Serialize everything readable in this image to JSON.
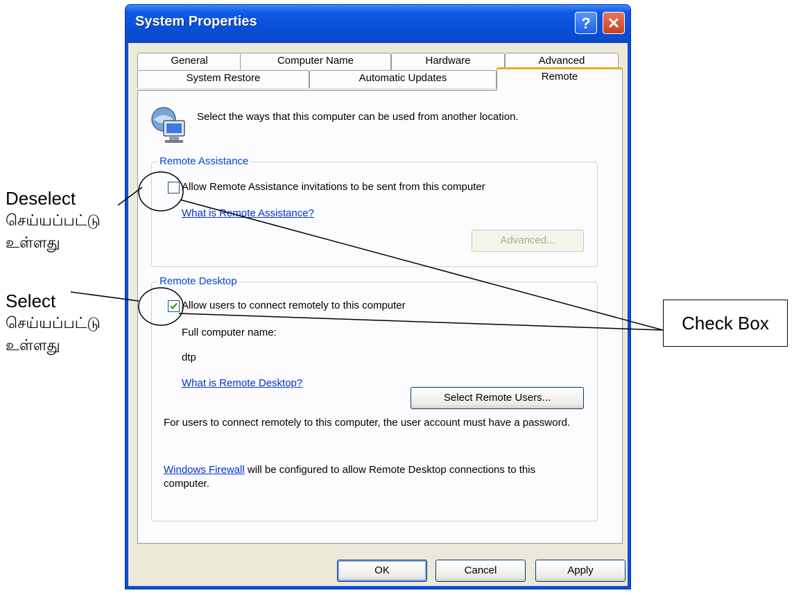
{
  "window": {
    "title": "System Properties",
    "help_icon": "help-icon",
    "close_icon": "close-icon"
  },
  "tabs_row1": [
    "General",
    "Computer Name",
    "Hardware",
    "Advanced"
  ],
  "tabs_row2": [
    "System Restore",
    "Automatic Updates",
    "Remote"
  ],
  "active_tab": "Remote",
  "intro": {
    "icon": "remote-computer-icon",
    "text": "Select the ways that this computer can be used from another location."
  },
  "remote_assistance": {
    "group_label": "Remote Assistance",
    "checkbox_label": "Allow Remote Assistance invitations to be sent from this computer",
    "checked": false,
    "help_link": "What is Remote Assistance?",
    "advanced_button": "Advanced..."
  },
  "remote_desktop": {
    "group_label": "Remote Desktop",
    "checkbox_label": "Allow users to connect remotely to this computer",
    "checked": true,
    "computer_name_label": "Full computer name:",
    "computer_name_value": "dtp",
    "help_link": "What is Remote Desktop?",
    "select_users_button": "Select Remote Users...",
    "password_note": "For users to connect remotely to this computer, the user account must have a password.",
    "firewall_link": "Windows Firewall",
    "firewall_note": " will be configured to allow Remote Desktop connections to this computer."
  },
  "dialog_buttons": {
    "ok": "OK",
    "cancel": "Cancel",
    "apply": "Apply"
  },
  "annotations": {
    "deselect_line1": "Deselect",
    "deselect_line2": "செய்யப்பட்டு",
    "deselect_line3": "உள்ளது",
    "select_line1": "Select",
    "select_line2": "செய்யப்பட்டு",
    "select_line3": "உள்ளது",
    "callout": "Check Box"
  },
  "colors": {
    "title_bar": "#0a4fd8",
    "dialog_face": "#ece9d8",
    "active_tab_accent": "#f5a623",
    "group_label": "#0046d5",
    "link": "#0033cc",
    "checkmark": "#21a121"
  }
}
